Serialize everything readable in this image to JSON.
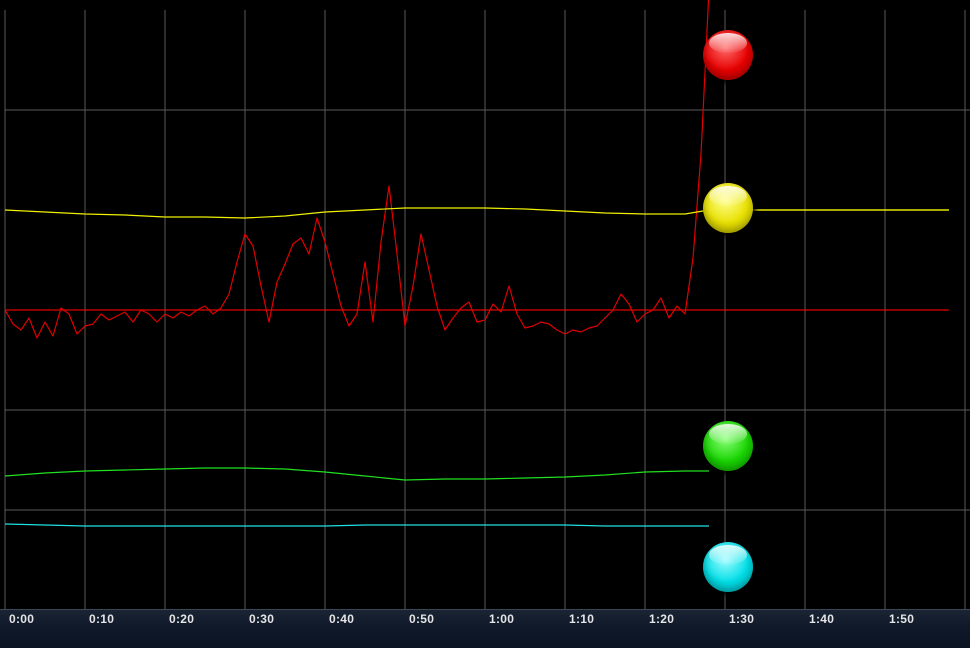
{
  "time_axis": {
    "labels": [
      "0:00",
      "0:10",
      "0:20",
      "0:30",
      "0:40",
      "0:50",
      "1:00",
      "1:10",
      "1:20",
      "1:30",
      "1:40",
      "1:50"
    ]
  },
  "indicators": [
    {
      "id": "red",
      "color": "#e60000",
      "highlight": "#ff6a6a"
    },
    {
      "id": "yellow",
      "color": "#e8e000",
      "highlight": "#ffff8a"
    },
    {
      "id": "green",
      "color": "#18d400",
      "highlight": "#8bff7a"
    },
    {
      "id": "cyan",
      "color": "#00dde6",
      "highlight": "#9cfcff"
    }
  ],
  "colors": {
    "background": "#000000",
    "grid": "#5a5a5a",
    "red": "#e00000",
    "yellow": "#f0f000",
    "green": "#20e020",
    "cyan": "#20e0e0"
  },
  "chart_data": {
    "type": "line",
    "x_unit": "seconds",
    "xlim": [
      0,
      118
    ],
    "grid": true,
    "current_time": 88,
    "series": [
      {
        "id": "red-trace",
        "color": "#e00000",
        "x": [
          0,
          1,
          2,
          3,
          4,
          5,
          6,
          7,
          8,
          9,
          10,
          11,
          12,
          13,
          14,
          15,
          16,
          17,
          18,
          19,
          20,
          21,
          22,
          23,
          24,
          25,
          26,
          27,
          28,
          29,
          30,
          31,
          32,
          33,
          34,
          35,
          36,
          37,
          38,
          39,
          40,
          41,
          42,
          43,
          44,
          45,
          46,
          47,
          48,
          49,
          50,
          51,
          52,
          53,
          54,
          55,
          56,
          57,
          58,
          59,
          60,
          61,
          62,
          63,
          64,
          65,
          66,
          67,
          68,
          69,
          70,
          71,
          72,
          73,
          74,
          75,
          76,
          77,
          78,
          79,
          80,
          81,
          82,
          83,
          84,
          85,
          86,
          87,
          88
        ],
        "y": [
          50,
          43,
          40,
          46,
          36,
          44,
          37,
          51,
          48,
          38,
          42,
          43,
          48,
          45,
          47,
          49,
          44,
          50,
          48,
          44,
          48,
          46,
          49,
          47,
          50,
          52,
          48,
          51,
          58,
          74,
          88,
          82,
          62,
          44,
          64,
          73,
          83,
          86,
          78,
          96,
          84,
          68,
          52,
          42,
          48,
          74,
          44,
          84,
          112,
          78,
          42,
          62,
          88,
          70,
          52,
          40,
          46,
          51,
          54,
          44,
          45,
          53,
          49,
          62,
          48,
          41,
          42,
          44,
          43,
          40,
          38,
          40,
          39,
          41,
          42,
          46,
          50,
          58,
          53,
          44,
          48,
          50,
          56,
          46,
          52,
          48,
          76,
          128,
          210
        ]
      },
      {
        "id": "yellow-trace",
        "color": "#f0f000",
        "x": [
          0,
          5,
          10,
          15,
          20,
          25,
          30,
          35,
          40,
          45,
          50,
          55,
          60,
          65,
          70,
          75,
          80,
          85,
          88,
          90,
          100,
          110,
          118
        ],
        "y": [
          100,
          99,
          98,
          97.5,
          96.5,
          96.5,
          96,
          97,
          99,
          100,
          101,
          101,
          101,
          100.5,
          99.5,
          98.5,
          98,
          98,
          100,
          100,
          100,
          100,
          100
        ]
      },
      {
        "id": "green-trace",
        "color": "#20e020",
        "x": [
          0,
          5,
          10,
          15,
          20,
          25,
          30,
          35,
          40,
          45,
          50,
          55,
          60,
          65,
          70,
          75,
          80,
          85,
          88
        ],
        "y": [
          -33,
          -31.5,
          -30.5,
          -30,
          -29.5,
          -29,
          -29,
          -29.5,
          -31,
          -33,
          -35,
          -34.5,
          -34.5,
          -34,
          -33.5,
          -32.5,
          -31,
          -30.5,
          -30.5
        ]
      },
      {
        "id": "cyan-trace",
        "color": "#20e0e0",
        "x": [
          0,
          5,
          10,
          15,
          20,
          25,
          30,
          35,
          40,
          45,
          50,
          55,
          60,
          65,
          70,
          75,
          80,
          85,
          88
        ],
        "y": [
          -57,
          -57.5,
          -58,
          -58,
          -58,
          -58,
          -58,
          -58,
          -58,
          -57.5,
          -57.5,
          -57.5,
          -57.5,
          -57.5,
          -57.5,
          -58,
          -58,
          -58,
          -58
        ]
      },
      {
        "id": "red-baseline",
        "color": "#e00000",
        "x": [
          0,
          118
        ],
        "y": [
          50,
          50
        ]
      },
      {
        "id": "yellow-baseline",
        "color": "#f0f000",
        "x": [
          88,
          118
        ],
        "y": [
          100,
          100
        ]
      }
    ]
  }
}
